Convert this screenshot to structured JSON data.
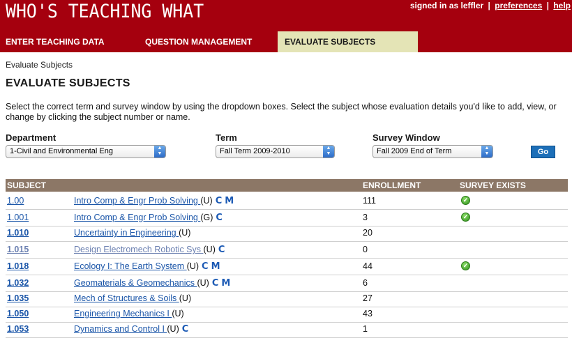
{
  "header": {
    "app_title": "WHO'S TEACHING WHAT",
    "signed_in_text": "signed in as leffler",
    "separator": "|",
    "preferences_link": "preferences",
    "help_link": "help",
    "brand_color": "#a5000e"
  },
  "tabs": [
    {
      "label": "ENTER TEACHING DATA",
      "active": false
    },
    {
      "label": "QUESTION MANAGEMENT",
      "active": false
    },
    {
      "label": "EVALUATE SUBJECTS",
      "active": true
    }
  ],
  "breadcrumb": "Evaluate Subjects",
  "page_title": "EVALUATE SUBJECTS",
  "instructions": "Select the correct term and survey window by using the dropdown boxes. Select the subject whose evaluation details you'd like to add, view, or change by clicking the subject number or name.",
  "filters": {
    "department_label": "Department",
    "department_value": "1-Civil and Environmental Eng",
    "term_label": "Term",
    "term_value": "Fall Term 2009-2010",
    "window_label": "Survey Window",
    "window_value": "Fall 2009 End of Term",
    "go_label": "Go"
  },
  "table": {
    "headers": {
      "subject": "SUBJECT",
      "enrollment": "ENROLLMENT",
      "survey_exists": "SURVEY EXISTS"
    },
    "badge_c": "C",
    "badge_m": "M",
    "rows": [
      {
        "number": "1.00",
        "name": "Intro Comp & Engr Prob Solving ",
        "level": "(U)",
        "c": true,
        "m": true,
        "enrollment": "111",
        "survey": true,
        "style": "normal"
      },
      {
        "number": "1.001",
        "name": "Intro Comp & Engr Prob Solving ",
        "level": "(G)",
        "c": true,
        "m": false,
        "enrollment": "3",
        "survey": true,
        "style": "normal"
      },
      {
        "number": "1.010",
        "name": "Uncertainty in Engineering ",
        "level": "(U)",
        "c": false,
        "m": false,
        "enrollment": "20",
        "survey": false,
        "style": "bold"
      },
      {
        "number": "1.015",
        "name": "Design Electromech Robotic Sys ",
        "level": "(U)",
        "c": true,
        "m": false,
        "enrollment": "0",
        "survey": false,
        "style": "dim"
      },
      {
        "number": "1.018",
        "name": "Ecology I: The Earth System ",
        "level": "(U)",
        "c": true,
        "m": true,
        "enrollment": "44",
        "survey": true,
        "style": "bold"
      },
      {
        "number": "1.032",
        "name": "Geomaterials & Geomechanics ",
        "level": "(U)",
        "c": true,
        "m": true,
        "enrollment": "6",
        "survey": false,
        "style": "bold"
      },
      {
        "number": "1.035",
        "name": "Mech of Structures & Soils ",
        "level": "(U)",
        "c": false,
        "m": false,
        "enrollment": "27",
        "survey": false,
        "style": "bold"
      },
      {
        "number": "1.050",
        "name": "Engineering Mechanics I ",
        "level": "(U)",
        "c": false,
        "m": false,
        "enrollment": "43",
        "survey": false,
        "style": "bold"
      },
      {
        "number": "1.053",
        "name": "Dynamics and Control I ",
        "level": "(U)",
        "c": true,
        "m": false,
        "enrollment": "1",
        "survey": false,
        "style": "bold"
      }
    ]
  }
}
